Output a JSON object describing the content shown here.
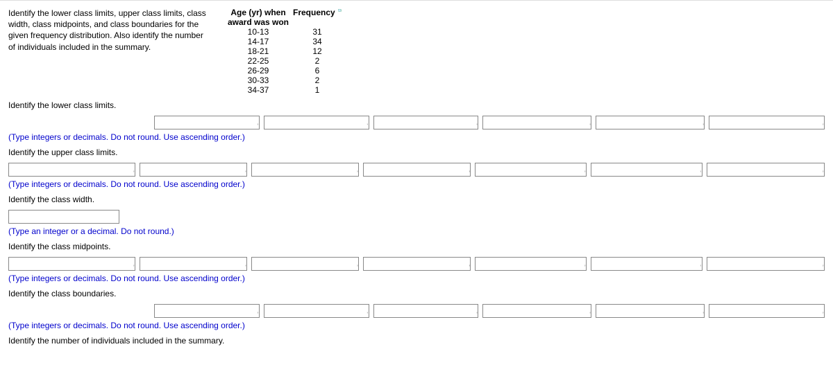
{
  "problem": {
    "statement": "Identify the lower class limits, upper class limits, class width, class midpoints, and class boundaries for the given frequency distribution. Also identify the number of individuals included in the summary."
  },
  "table": {
    "header_age_line1": "Age (yr) when",
    "header_age_line2": "award was won",
    "header_freq": "Frequency",
    "rows": [
      {
        "age": "10-13",
        "freq": "31"
      },
      {
        "age": "14-17",
        "freq": "34"
      },
      {
        "age": "18-21",
        "freq": "12"
      },
      {
        "age": "22-25",
        "freq": "2"
      },
      {
        "age": "26-29",
        "freq": "6"
      },
      {
        "age": "30-33",
        "freq": "2"
      },
      {
        "age": "34-37",
        "freq": "1"
      }
    ]
  },
  "prompts": {
    "lower_limits": "Identify the lower class limits.",
    "upper_limits": "Identify the upper class limits.",
    "class_width": "Identify the class width.",
    "midpoints": "Identify the class midpoints.",
    "boundaries": "Identify the class boundaries.",
    "individuals": "Identify the number of individuals included in the summary."
  },
  "hints": {
    "ascending": "(Type integers or decimals. Do not round. Use ascending order.)",
    "single": "(Type an integer or a decimal. Do not round.)"
  }
}
